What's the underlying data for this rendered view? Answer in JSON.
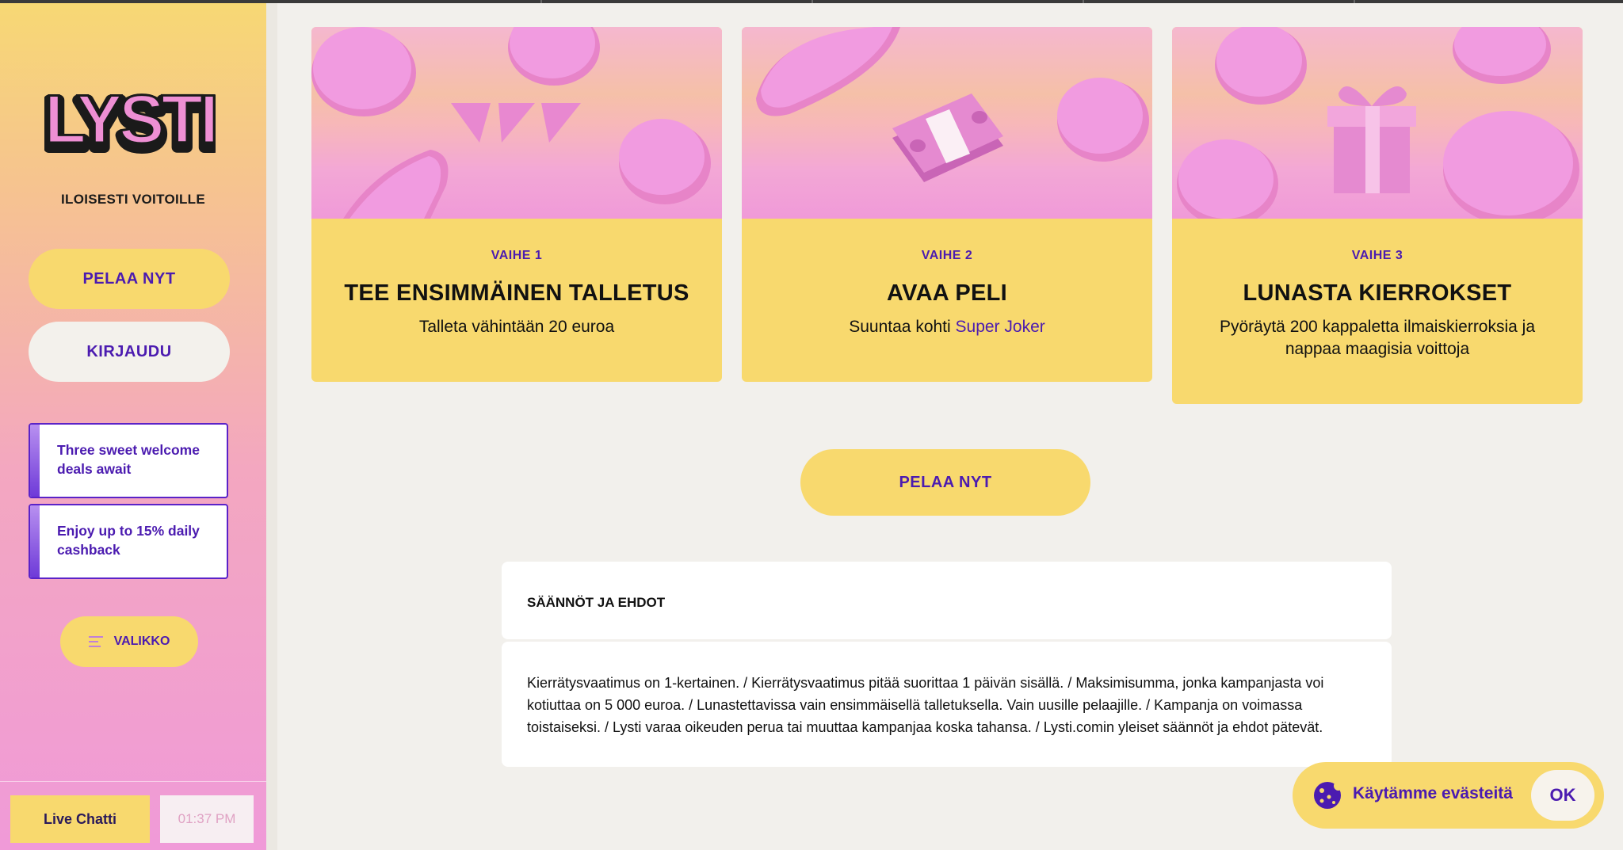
{
  "sidebar": {
    "logo_text": "LYSTI",
    "tagline": "ILOISESTI VOITOILLE",
    "play_button": "PELAA NYT",
    "login_button": "KIRJAUDU",
    "promos": [
      {
        "label": "Three sweet welcome deals await"
      },
      {
        "label": "Enjoy up to 15% daily cashback"
      }
    ],
    "menu_button": "VALIKKO",
    "live_chat": "Live Chatti",
    "time": "01:37 PM"
  },
  "steps": [
    {
      "step": "VAIHE 1",
      "title": "TEE ENSIMMÄINEN TALLETUS",
      "desc": "Talleta vähintään 20 euroa",
      "image_icon": "provider-logo-triangles"
    },
    {
      "step": "VAIHE 2",
      "title": "AVAA PELI",
      "desc_prefix": "Suuntaa kohti ",
      "desc_link": "Super Joker",
      "image_icon": "cash-bundle-icon"
    },
    {
      "step": "VAIHE 3",
      "title": "LUNASTA KIERROKSET",
      "desc": "Pyöräytä 200 kappaletta ilmaiskierroksia ja nappaa maagisia voittoja",
      "image_icon": "gift-box-icon"
    }
  ],
  "cta_button": "PELAA NYT",
  "terms": {
    "heading": "SÄÄNNÖT JA EHDOT",
    "body": "Kierrätysvaatimus on 1-kertainen. / Kierrätysvaatimus pitää suorittaa 1 päivän sisällä. / Maksimisumma, jonka kampanjasta voi kotiuttaa on 5 000 euroa. / Lunastettavissa vain ensimmäisellä talletuksella. Vain uusille pelaajille. / Kampanja on voimassa toistaiseksi. / Lysti varaa oikeuden perua tai muuttaa kampanjaa koska tahansa. / Lysti.comin yleiset säännöt ja ehdot pätevät."
  },
  "cookie_banner": {
    "text": "Käytämme evästeitä",
    "ok": "OK"
  },
  "colors": {
    "accent_yellow": "#f8d96e",
    "brand_purple": "#4b1bb0",
    "coin_pink": "#ee9ad6",
    "background": "#f2f0ec"
  }
}
